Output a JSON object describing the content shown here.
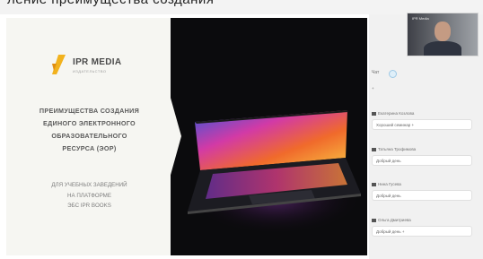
{
  "top_strip": {
    "cut_text": "ление преимущества создания"
  },
  "slide": {
    "logo": {
      "name": "IPR MEDIA",
      "tagline": "ИЗДАТЕЛЬСТВО"
    },
    "title_lines": [
      "ПРЕИМУЩЕСТВА СОЗДАНИЯ",
      "ЕДИНОГО ЭЛЕКТРОННОГО",
      "ОБРАЗОВАТЕЛЬНОГО",
      "РЕСУРСА (ЭОР)"
    ],
    "subtitle_lines": [
      "ДЛЯ УЧЕБНЫХ ЗАВЕДЕНИЙ",
      "НА ПЛАТФОРМЕ",
      "ЭБС IPR BOOKS"
    ]
  },
  "video": {
    "participant_label": "IPR Media"
  },
  "chat": {
    "header": "Чат",
    "first_line": "+",
    "messages": [
      {
        "author": "Екатерина Козлова",
        "text": "Хороший семинар +"
      },
      {
        "author": "Татьяна Трофимова",
        "text": "Добрый день"
      },
      {
        "author": "Нина Гусева",
        "text": "Добрый день"
      },
      {
        "author": "Ольга Дмитриева",
        "text": "Добрый день +"
      }
    ]
  },
  "colors": {
    "slide_bg": "#0b0b0d",
    "panel": "#f6f6f2",
    "logo_accent": "#f2b21d",
    "sidebar": "#f1f1f1"
  },
  "icons": [
    "ipr-logo-icon",
    "laptop-image",
    "chat-status-icon",
    "user-icon"
  ]
}
